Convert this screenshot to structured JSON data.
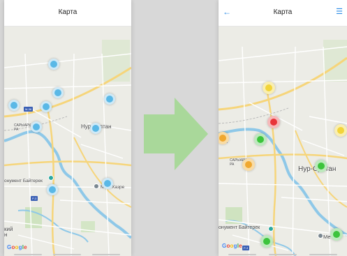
{
  "left_screen": {
    "title": "Карта",
    "map_labels": {
      "city": "Нур-Султан",
      "district": "САРЫАРК РА",
      "monument": "онумент Байтерек",
      "poi": "Ме  ь Хазре",
      "corner_text": "кий н",
      "road_m36": "M-36",
      "road_p": "P-3"
    },
    "attribution": "Google",
    "marker_color": "#5ab8e6",
    "markers": [
      {
        "name": "cluster-marker-1",
        "color": "blue"
      },
      {
        "name": "cluster-marker-2",
        "color": "blue"
      },
      {
        "name": "cluster-marker-3",
        "color": "blue"
      },
      {
        "name": "cluster-marker-4",
        "color": "blue"
      },
      {
        "name": "cluster-marker-5",
        "color": "blue"
      },
      {
        "name": "cluster-marker-6",
        "color": "blue"
      },
      {
        "name": "cluster-marker-7",
        "color": "blue"
      },
      {
        "name": "cluster-marker-8",
        "color": "blue"
      },
      {
        "name": "cluster-marker-9",
        "color": "blue"
      },
      {
        "name": "cluster-marker-10",
        "color": "blue"
      }
    ]
  },
  "right_screen": {
    "title": "Карта",
    "back_icon": "arrow-left-icon",
    "list_icon": "list-icon",
    "accent_color": "#2b8be6",
    "map_labels": {
      "city": "Нур-Султан",
      "district": "САРЫАРК РА",
      "monument": "онумент Байтерек",
      "poi": "Ме   Х",
      "road_m36": "M-36",
      "road_p": "P-3"
    },
    "attribution": "Google",
    "marker_colors": {
      "yellow": "#f2d43a",
      "red": "#e8343a",
      "green": "#3cc43c",
      "orange": "#f0a830"
    }
  },
  "transition_arrow_color": "#a9d89a"
}
